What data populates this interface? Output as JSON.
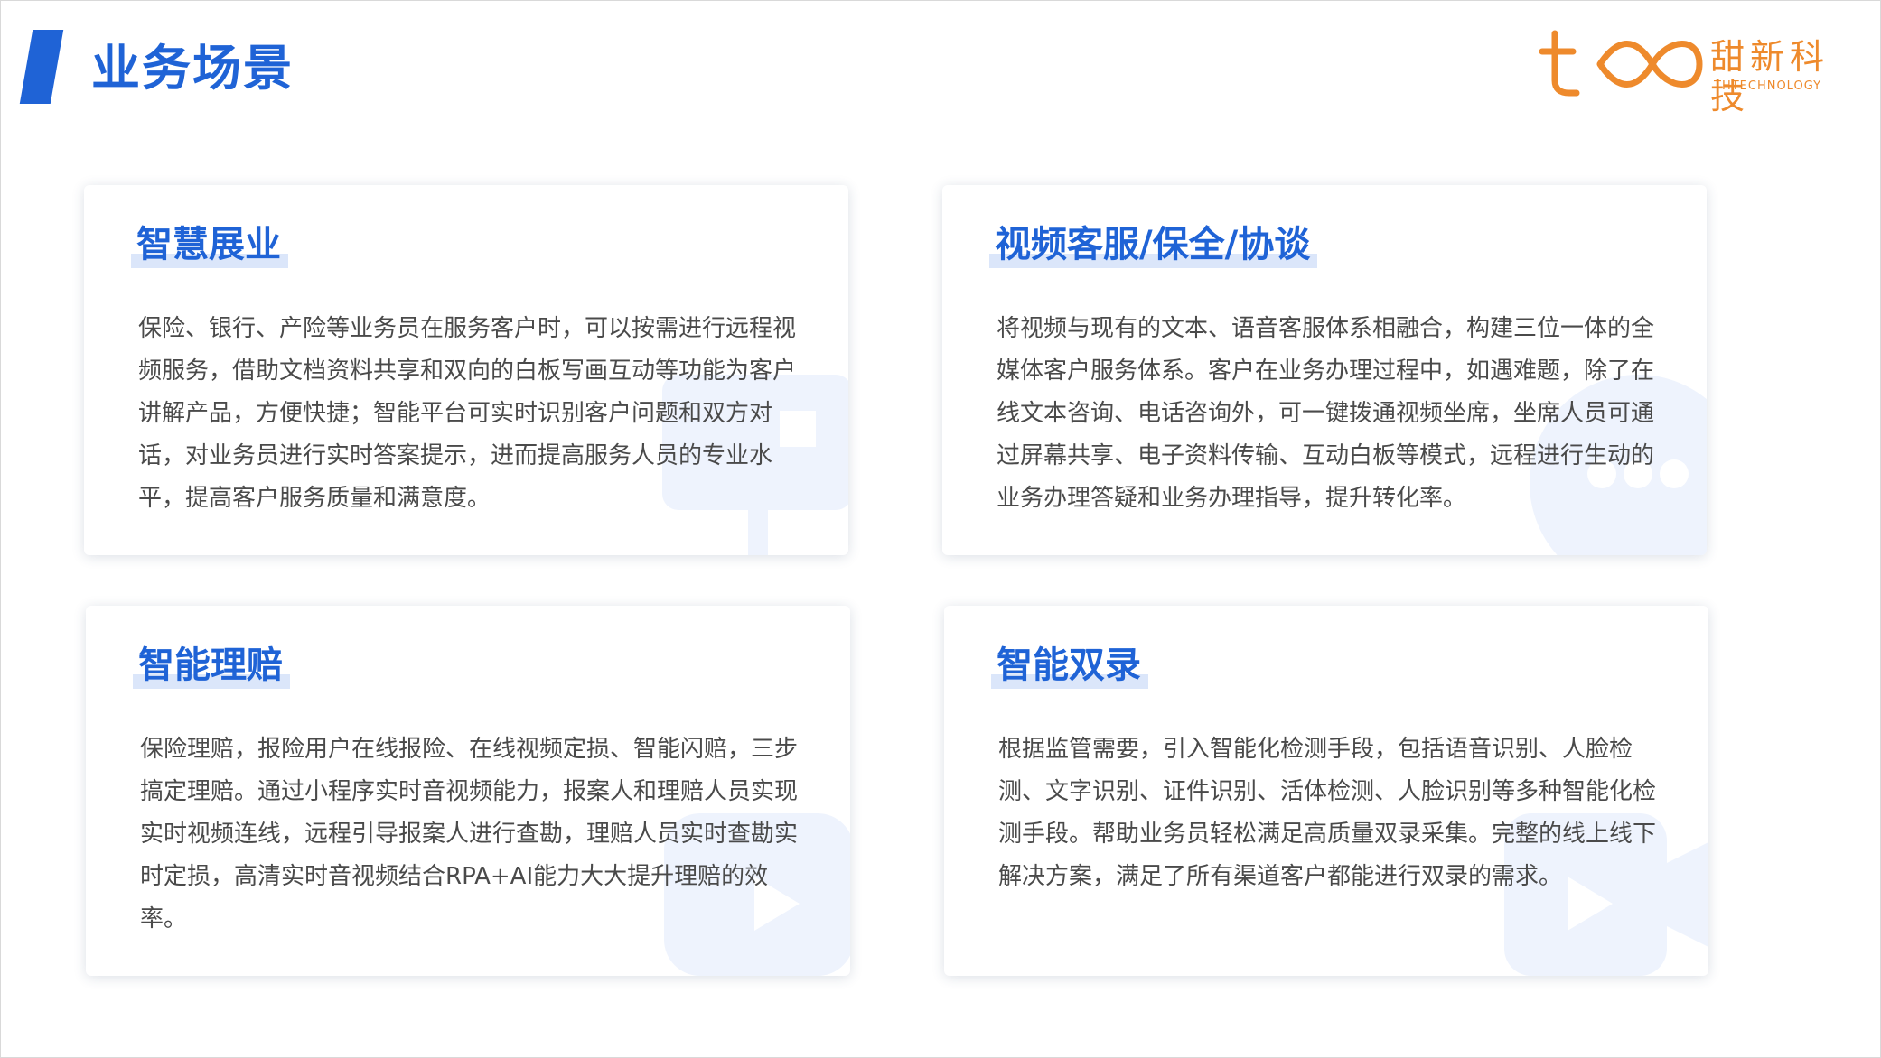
{
  "header": {
    "title": "业务场景",
    "logo": {
      "name_cn": "甜新科技",
      "name_en": "THTECHNOLOGY",
      "color": "#ee8a2c"
    }
  },
  "accent_color": "#1f63d6",
  "cards": [
    {
      "title": "智慧展业",
      "body": "保险、银行、产险等业务员在服务客户时，可以按需进行远程视频服务，借助文档资料共享和双向的白板写画互动等功能为客户讲解产品，方便快捷；智能平台可实时识别客户问题和双方对话，对业务员进行实时答案提示，进而提高服务人员的专业水平，提高客户服务质量和满意度。",
      "icon": "presentation-board-icon"
    },
    {
      "title": "视频客服/保全/协谈",
      "body": "将视频与现有的文本、语音客服体系相融合，构建三位一体的全媒体客户服务体系。客户在业务办理过程中，如遇难题，除了在线文本咨询、电话咨询外，可一键拨通视频坐席，坐席人员可通过屏幕共享、电子资料传输、互动白板等模式，远程进行生动的业务办理答疑和业务办理指导，提升转化率。",
      "icon": "chat-bubble-icon"
    },
    {
      "title": "智能理赔",
      "body": "保险理赔，报险用户在线报险、在线视频定损、智能闪赔，三步搞定理赔。通过小程序实时音视频能力，报案人和理赔人员实现实时视频连线，远程引导报案人进行查勘，理赔人员实时查勘实时定损，高清实时音视频结合RPA+AI能力大大提升理赔的效率。",
      "icon": "video-play-icon"
    },
    {
      "title": "智能双录",
      "body": "根据监管需要，引入智能化检测手段，包括语音识别、人脸检测、文字识别、证件识别、活体检测、人脸识别等多种智能化检测手段。帮助业务员轻松满足高质量双录采集。完整的线上线下解决方案，满足了所有渠道客户都能进行双录的需求。",
      "icon": "video-camera-icon"
    }
  ]
}
